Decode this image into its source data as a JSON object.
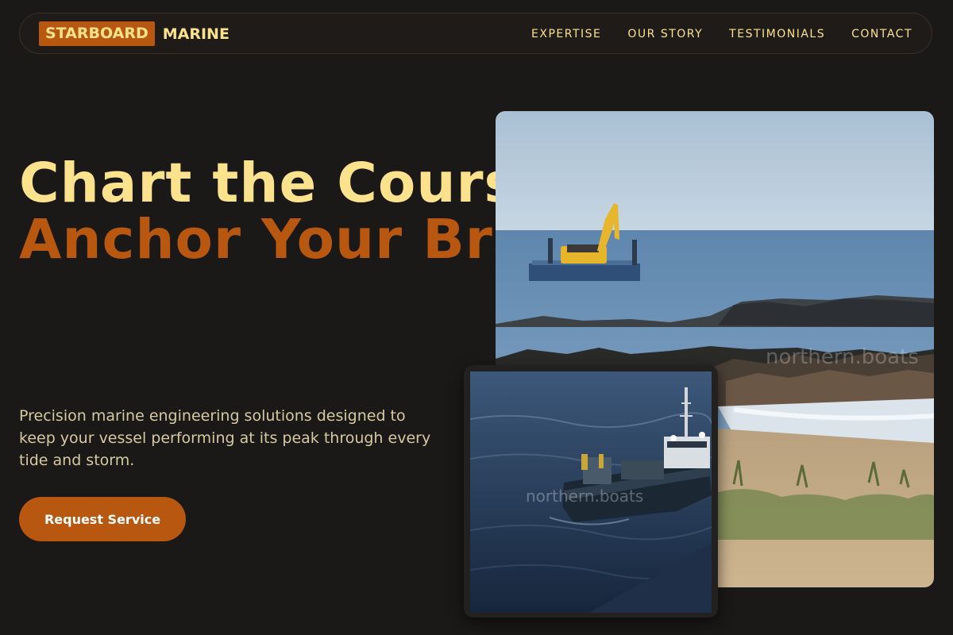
{
  "nav": {
    "brand_highlight": "STARBOARD",
    "brand_rest": "MARINE",
    "links": [
      "EXPERTISE",
      "OUR STORY",
      "TESTIMONIALS",
      "CONTACT"
    ]
  },
  "hero": {
    "title_line1": "Chart the Course,",
    "title_line2": "Anchor Your Brand.",
    "description": "Precision marine engineering solutions designed to keep your vessel performing at its peak through every tide and storm.",
    "cta_label": "Request Service"
  },
  "images": {
    "main_watermark": "northern.boats",
    "inset_watermark": "northern.boats"
  },
  "colors": {
    "background": "#1b1918",
    "accent": "#b8570f",
    "cream": "#fce28c"
  }
}
